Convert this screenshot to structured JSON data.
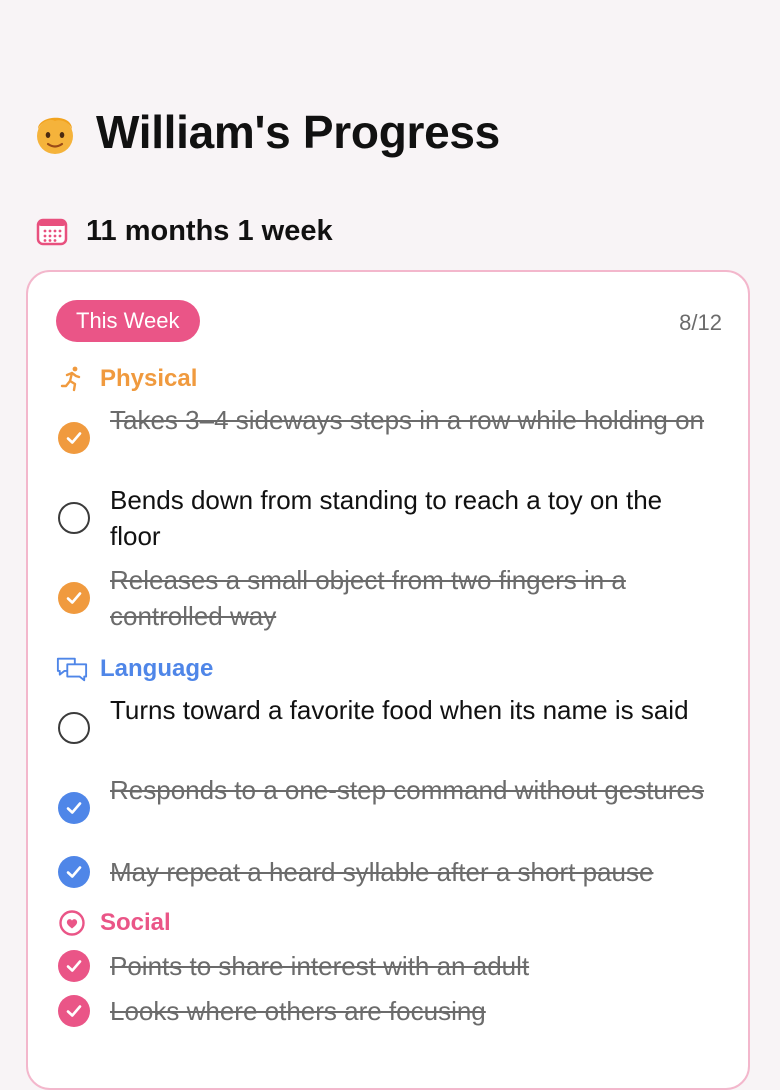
{
  "header": {
    "title": "William's Progress",
    "avatar_icon": "boy-emoji-icon"
  },
  "age": {
    "icon": "calendar-icon",
    "text": "11 months 1 week"
  },
  "card": {
    "badge": "This Week",
    "progress": "8/12",
    "accent_color": "#ea5587"
  },
  "sections": [
    {
      "label": "Physical",
      "icon": "running-person-icon",
      "color": "#f09a3e",
      "items": [
        {
          "text": "Takes 3–4 sideways steps in a row while holding on",
          "done": true
        },
        {
          "text": "Bends down from standing to reach a toy on the floor",
          "done": false
        },
        {
          "text": "Releases a small object from two fingers in a controlled way",
          "done": true
        }
      ]
    },
    {
      "label": "Language",
      "icon": "speech-bubbles-icon",
      "color": "#4f86e8",
      "items": [
        {
          "text": "Turns toward a favorite food when its name is said",
          "done": false
        },
        {
          "text": "Responds to a one-step command without gestures",
          "done": true
        },
        {
          "text": "May repeat a heard syllable after a short pause",
          "done": true
        }
      ]
    },
    {
      "label": "Social",
      "icon": "heart-circle-icon",
      "color": "#ea5587",
      "items": [
        {
          "text": "Points to share interest with an adult",
          "done": true
        },
        {
          "text": "Looks where others are focusing",
          "done": true
        }
      ]
    }
  ]
}
